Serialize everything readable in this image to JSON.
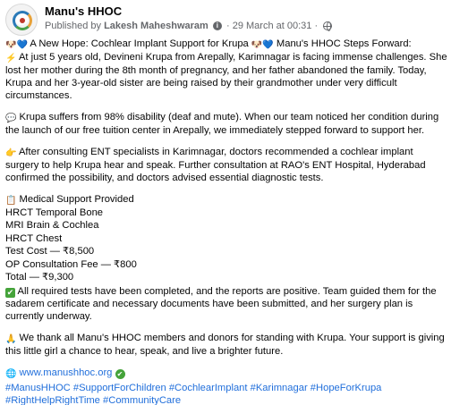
{
  "header": {
    "page_name": "Manu's HHOC",
    "published_by_prefix": "Published by",
    "author": "Lakesh Maheshwaram",
    "date": "29 March at 00:31",
    "separator": "·"
  },
  "post": {
    "intro_title": " A New Hope: Cochlear Implant Support for Krupa ",
    "intro_title_2": " Manu's HHOC Steps Forward:",
    "intro_body": " At just 5 years old, Devineni Krupa from Arepally, Karimnagar is facing immense challenges. She lost her mother during the 8th month of pregnancy, and her father abandoned the family. Today, Krupa and her 3-year-old sister are being raised by their grandmother under very difficult circumstances.",
    "disability": " Krupa suffers from 98% disability (deaf and mute). When our team noticed her condition during the launch of our free tuition center in Arepally, we immediately stepped forward to support her.",
    "ent": " After consulting ENT specialists in Karimnagar, doctors recommended a cochlear implant surgery to help Krupa hear and speak. Further consultation at RAO's ENT Hospital, Hyderabad confirmed the possibility, and doctors advised essential diagnostic tests.",
    "support_heading": " Medical Support Provided",
    "support_items": [
      "HRCT Temporal Bone",
      "MRI Brain & Cochlea",
      "HRCT Chest",
      "Test Cost — ₹8,500",
      "OP Consultation Fee — ₹800",
      "Total — ₹9,300"
    ],
    "tests_done": " All required tests have been completed, and the reports are positive. Team guided them for the sadarem certificate and necessary documents have been submitted, and her surgery plan is currently underway.",
    "thanks": " We thank all Manu's HHOC members and donors for standing with Krupa. Your support is giving this little girl a chance to hear, speak, and live a brighter future.",
    "website": " www.manushhoc.org",
    "hashtags": [
      "#ManusHHOC",
      "#SupportForChildren",
      "#CochlearImplant",
      "#Karimnagar",
      "#HopeForKrupa",
      "#RightHelpRightTime",
      "#CommunityCare"
    ]
  },
  "icons": {
    "avatar": "manus-hhoc-logo",
    "emoji_dog": "🐶",
    "emoji_heart": "💙",
    "emoji_zap": "⚡",
    "emoji_speech": "💬",
    "emoji_hand": "👉",
    "emoji_clip": "📋",
    "emoji_check": "✔",
    "emoji_pray": "🙏",
    "emoji_globe": "🌐",
    "emoji_verified": "✔"
  },
  "colors": {
    "text": "#050505",
    "meta": "#65676b",
    "link": "#216fdb",
    "check_green": "#45a33a"
  }
}
